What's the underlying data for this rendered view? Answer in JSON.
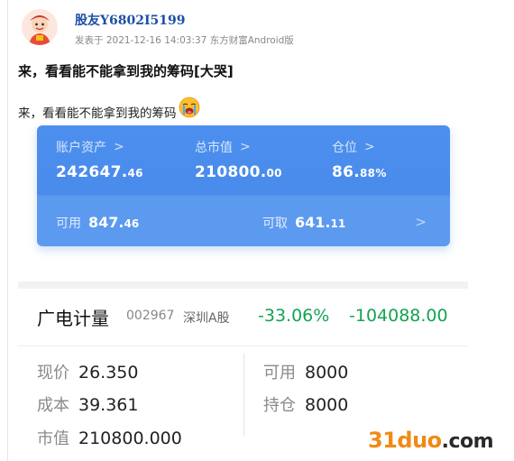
{
  "post": {
    "username": "股友Y6802I5199",
    "meta": "发表于 2021-12-16 14:03:37 东方财富Android版",
    "title": "来，看看能不能拿到我的筹码[大哭]",
    "body": "来，看看能不能拿到我的筹码",
    "avatar_icon": "cartoon-avatar-icon",
    "emoji_icon": "crying-emoji-icon"
  },
  "account": {
    "total_assets": {
      "label": "账户资产",
      "int": "242647.",
      "dec": "46"
    },
    "market_value": {
      "label": "总市值",
      "int": "210800.",
      "dec": "00"
    },
    "position": {
      "label": "仓位",
      "int": "86.",
      "dec": "88%"
    },
    "available": {
      "label": "可用",
      "int": "847.",
      "dec": "46"
    },
    "withdrawable": {
      "label": "可取",
      "int": "641.",
      "dec": "11"
    },
    "chevron": ">",
    "colors": {
      "card": "#4a8bec",
      "card_bottom": "#5c9af0"
    }
  },
  "stock": {
    "name": "广电计量",
    "code": "002967",
    "market": "深圳A股",
    "change_pct": "-33.06%",
    "profit_loss": "-104088.00",
    "colors": {
      "loss": "#13a452"
    },
    "fields": {
      "price_label": "现价",
      "price": "26.350",
      "cost_label": "成本",
      "cost": "39.361",
      "mv_label": "市值",
      "mv": "210800.000",
      "avail_label": "可用",
      "avail": "8000",
      "hold_label": "持仓",
      "hold": "8000"
    }
  },
  "watermark": {
    "part1": "31duo",
    "part2": ".com",
    "colors": {
      "orange": "#f08a16"
    }
  }
}
